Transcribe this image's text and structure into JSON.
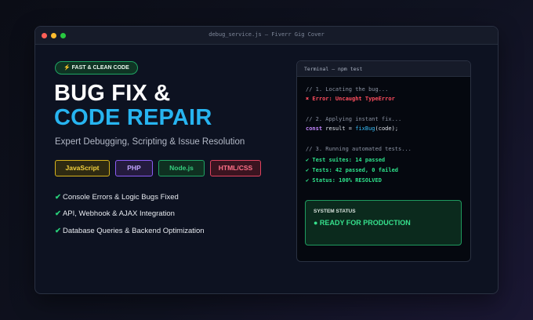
{
  "window": {
    "title": "debug_service.js — Fiverr Gig Cover"
  },
  "badge": {
    "icon": "lightning-icon",
    "glyph": "⚡",
    "label": "FAST & CLEAN CODE"
  },
  "headline": {
    "line1": "BUG FIX &",
    "line2": "CODE REPAIR"
  },
  "subtitle": "Expert Debugging, Scripting & Issue Resolution",
  "tags": [
    "JavaScript",
    "PHP",
    "Node.js",
    "HTML/CSS"
  ],
  "features": {
    "check": "✔",
    "items": [
      "Console Errors & Logic Bugs Fixed",
      "API, Webhook & AJAX Integration",
      "Database Queries & Backend Optimization"
    ]
  },
  "terminal": {
    "title": "Terminal — npm test",
    "line1": "// 1. Locating the bug...",
    "line2": "✖ Error: Uncaught TypeError",
    "line3": "// 2. Applying instant fix...",
    "line4": {
      "keyword": "const",
      "code": " result = ",
      "fn": "fixBug",
      "tail": "(code);"
    },
    "line5": "// 3. Running automated tests...",
    "line6": "✔ Test suites: 14 passed",
    "line7": "✔ Tests: 42 passed, 0 failed",
    "line8": "✔ Status: 100% RESOLVED",
    "status": {
      "label": "SYSTEM STATUS",
      "value": "● READY FOR PRODUCTION"
    }
  },
  "colors": {
    "accent_blue": "#27b4f0",
    "success_green": "#2ee08a",
    "error_red": "#ff4d5e",
    "background": "#0d1221"
  }
}
